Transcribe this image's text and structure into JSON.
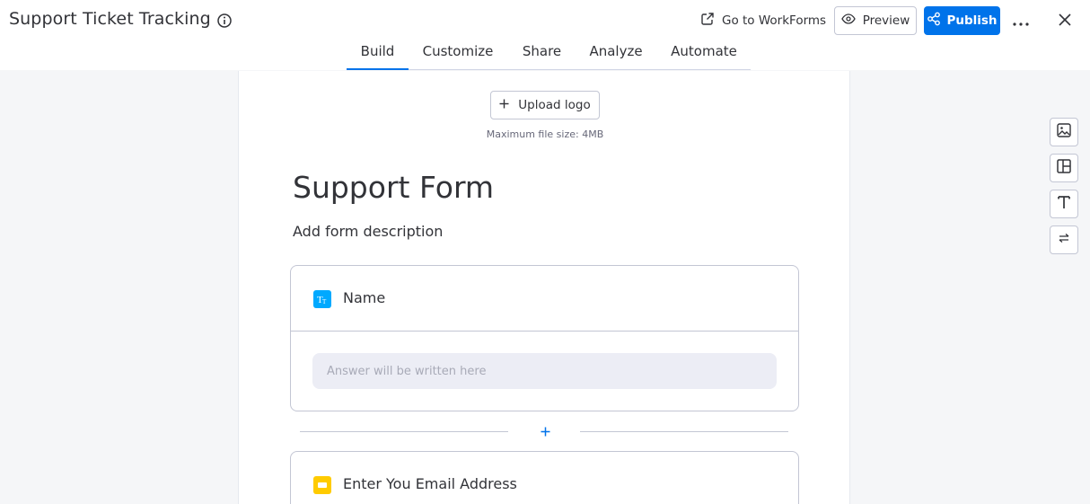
{
  "header": {
    "title": "Support Ticket Tracking",
    "goto_label": "Go to WorkForms",
    "preview_label": "Preview",
    "publish_label": "Publish",
    "icons": [
      "info-icon",
      "external-link-icon",
      "eye-icon",
      "share-nodes-icon",
      "more-icon",
      "close-icon"
    ]
  },
  "tabs": [
    {
      "label": "Build",
      "active": true
    },
    {
      "label": "Customize",
      "active": false
    },
    {
      "label": "Share",
      "active": false
    },
    {
      "label": "Analyze",
      "active": false
    },
    {
      "label": "Automate",
      "active": false
    }
  ],
  "form": {
    "upload_label": "Upload logo",
    "upload_note": "Maximum file size: 4MB",
    "title": "Support Form",
    "description": "Add form description",
    "questions": [
      {
        "label": "Name",
        "icon": "text-type-icon",
        "icon_color": "#00a9ff",
        "placeholder": "Answer will be written here"
      },
      {
        "label": "Enter You Email Address",
        "icon": "email-icon",
        "icon_color": "#ffcb00"
      }
    ]
  },
  "side_tools": [
    "image-icon",
    "layout-icon",
    "text-icon",
    "swap-icon"
  ],
  "colors": {
    "accent": "#0073ea",
    "background": "#f5f6f8",
    "border": "#c3c6d4",
    "answer_bg": "#ecedf5"
  }
}
